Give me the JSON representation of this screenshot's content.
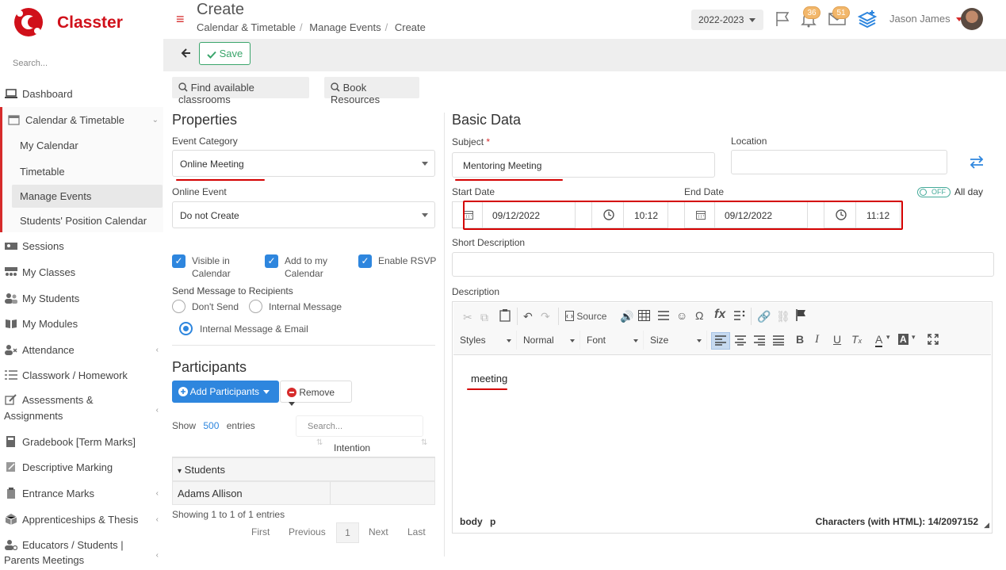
{
  "brand": {
    "name": "Classter"
  },
  "sidebar": {
    "search_placeholder": "Search...",
    "items": [
      {
        "label": "Dashboard"
      },
      {
        "label": "Calendar & Timetable"
      },
      {
        "label": "My Calendar"
      },
      {
        "label": "Timetable"
      },
      {
        "label": "Manage Events"
      },
      {
        "label": "Students' Position Calendar"
      },
      {
        "label": "Sessions"
      },
      {
        "label": "My Classes"
      },
      {
        "label": "My Students"
      },
      {
        "label": "My Modules"
      },
      {
        "label": "Attendance"
      },
      {
        "label": "Classwork / Homework"
      },
      {
        "label": "Assessments &"
      },
      {
        "label": "Assignments"
      },
      {
        "label": "Gradebook [Term Marks]"
      },
      {
        "label": "Descriptive Marking"
      },
      {
        "label": "Entrance Marks"
      },
      {
        "label": "Apprenticeships & Thesis"
      },
      {
        "label": "Educators / Students |"
      },
      {
        "label": "Parents Meetings"
      }
    ]
  },
  "header": {
    "title": "Create",
    "breadcrumbs": [
      "Calendar & Timetable",
      "Manage Events",
      "Create"
    ],
    "year": "2022-2023",
    "notifications_count": "36",
    "messages_count": "51",
    "user_name": "Jason James"
  },
  "toolbar": {
    "save_label": "Save"
  },
  "actions": {
    "find_classrooms": "Find available classrooms",
    "book_resources": "Book Resources"
  },
  "properties": {
    "title": "Properties",
    "event_category_label": "Event Category",
    "event_category_value": "Online Meeting",
    "online_event_label": "Online Event",
    "online_event_value": "Do not Create",
    "checkboxes": [
      {
        "line1": "Visible in",
        "line2": "Calendar",
        "checked": true
      },
      {
        "line1": "Add to my",
        "line2": "Calendar",
        "checked": true
      },
      {
        "line1": "Enable RSVP",
        "line2": "",
        "checked": true
      }
    ],
    "send_message_label": "Send Message to Recipients",
    "radio_options": [
      {
        "label": "Don't Send",
        "selected": false
      },
      {
        "label": "Internal Message",
        "selected": false
      },
      {
        "label": "Internal Message & Email",
        "selected": true
      }
    ]
  },
  "participants": {
    "title": "Participants",
    "add_label": "Add Participants",
    "remove_label": "Remove",
    "show_label": "Show",
    "entries_count": "500",
    "entries_label": "entries",
    "search_placeholder": "Search...",
    "column_intention": "Intention",
    "group_label": "Students",
    "rows": [
      {
        "name": "Adams Allison",
        "intention": ""
      }
    ],
    "info": "Showing 1 to 1 of 1 entries",
    "pager": {
      "first": "First",
      "previous": "Previous",
      "page": "1",
      "next": "Next",
      "last": "Last"
    }
  },
  "basic_data": {
    "title": "Basic Data",
    "subject_label": "Subject",
    "required_mark": "*",
    "subject_value": "Mentoring Meeting",
    "location_label": "Location",
    "location_value": "",
    "start_date_label": "Start Date",
    "end_date_label": "End Date",
    "start_date": "09/12/2022",
    "start_time": "10:12",
    "end_date": "09/12/2022",
    "end_time": "11:12",
    "all_day_toggle": "OFF",
    "all_day_label": "All day",
    "short_desc_label": "Short Description",
    "short_desc_value": "",
    "desc_label": "Description"
  },
  "editor": {
    "source_label": "Source",
    "dropdowns": [
      "Styles",
      "Normal",
      "Font",
      "Size"
    ],
    "content": "meeting",
    "status_path": [
      "body",
      "p"
    ],
    "char_count": "Characters (with HTML): 14/2097152"
  },
  "colors": {
    "accent_red": "#d62b2b",
    "primary_blue": "#2e86de",
    "save_green": "#3aa56b",
    "annotation_red": "#d40000"
  }
}
